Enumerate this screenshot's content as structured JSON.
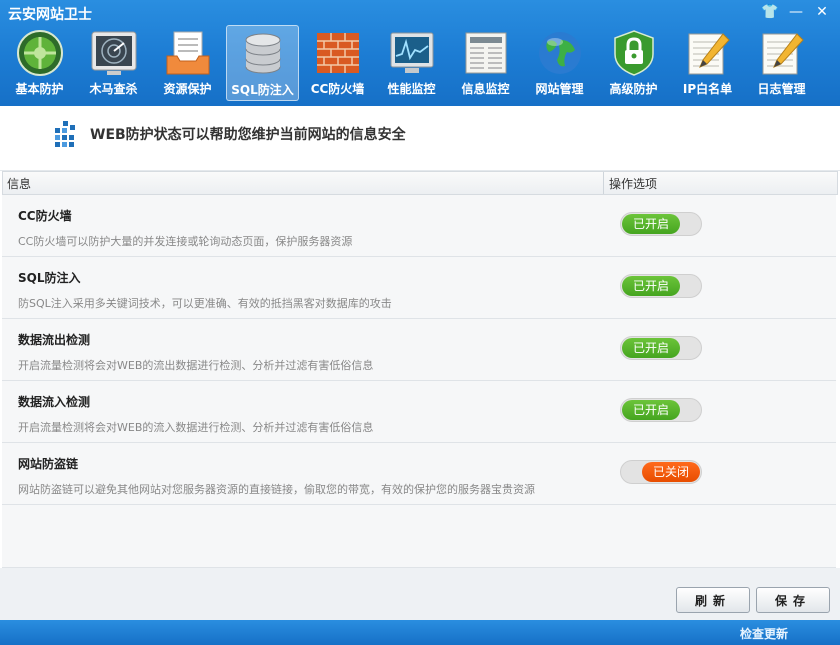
{
  "app": {
    "title": "云安网站卫士"
  },
  "window_controls": {
    "skin": "👕",
    "minimize": "—",
    "close": "✕"
  },
  "toolbar": [
    {
      "label": "基本防护",
      "icon": "shield-radar-icon"
    },
    {
      "label": "木马查杀",
      "icon": "radar-scan-icon"
    },
    {
      "label": "资源保护",
      "icon": "document-tray-icon"
    },
    {
      "label": "SQL防注入",
      "icon": "database-icon",
      "active": true
    },
    {
      "label": "CC防火墙",
      "icon": "brick-wall-icon"
    },
    {
      "label": "性能监控",
      "icon": "monitor-chart-icon"
    },
    {
      "label": "信息监控",
      "icon": "newspaper-icon"
    },
    {
      "label": "网站管理",
      "icon": "globe-icon"
    },
    {
      "label": "高级防护",
      "icon": "padlock-shield-icon"
    },
    {
      "label": "IP白名单",
      "icon": "notepad-pencil-icon"
    },
    {
      "label": "日志管理",
      "icon": "notepad-pencil-icon"
    }
  ],
  "banner": {
    "text": "WEB防护状态可以帮助您维护当前网站的信息安全"
  },
  "table": {
    "header_info": "信息",
    "header_options": "操作选项",
    "rows": [
      {
        "title": "CC防火墙",
        "desc": "CC防火墙可以防护大量的并发连接或轮询动态页面，保护服务器资源",
        "status": "已开启",
        "on": true
      },
      {
        "title": "SQL防注入",
        "desc": "防SQL注入采用多关键词技术，可以更准确、有效的抵挡黑客对数据库的攻击",
        "status": "已开启",
        "on": true
      },
      {
        "title": "数据流出检测",
        "desc": "开启流量检测将会对WEB的流出数据进行检测、分析并过滤有害低俗信息",
        "status": "已开启",
        "on": true
      },
      {
        "title": "数据流入检测",
        "desc": "开启流量检测将会对WEB的流入数据进行检测、分析并过滤有害低俗信息",
        "status": "已开启",
        "on": true
      },
      {
        "title": "网站防盗链",
        "desc": "网站防盗链可以避免其他网站对您服务器资源的直接链接，偷取您的带宽，有效的保护您的服务器宝贵资源",
        "status": "已关闭",
        "on": false
      }
    ]
  },
  "footer": {
    "refresh_label": "刷新",
    "save_label": "保存"
  },
  "statusbar": {
    "update_label": "检查更新"
  },
  "colors": {
    "title_blue": "#1d7dd4",
    "toggle_on": "#45a520",
    "toggle_off": "#e84d00"
  }
}
